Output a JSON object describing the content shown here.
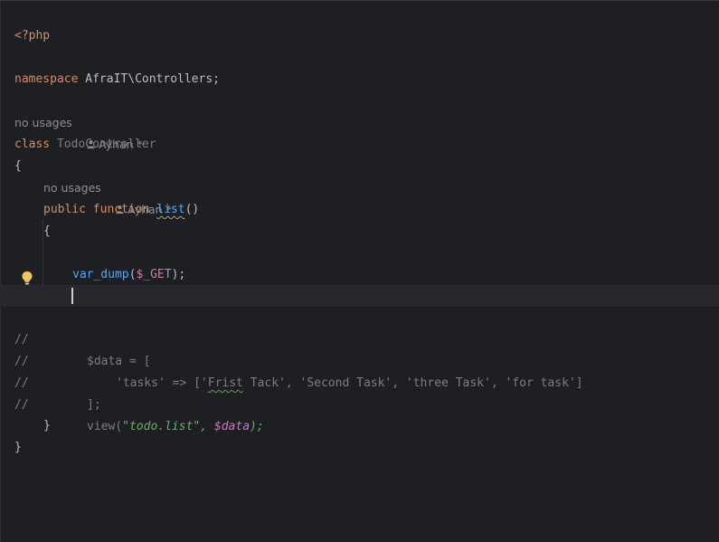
{
  "editor": {
    "lines": {
      "php_open": "<?php",
      "namespace_kw": "namespace",
      "namespace_name": " AfraIT\\Controllers;",
      "class_kw": "class",
      "class_name": " TodoController",
      "open_brace": "{",
      "public_kw": "public",
      "function_kw": " function ",
      "method_name": "list",
      "method_parens": "()",
      "method_open": "{",
      "var_dump_fn": "var_dump",
      "var_dump_open": "(",
      "var_dump_arg": "$_GET",
      "var_dump_close": ");",
      "c1_slashes": "//",
      "c1_code": "$data = [",
      "c2_slashes": "//",
      "c2_a": "'tasks' => ['",
      "c2_frist": "Frist",
      "c2_b": " Tack', 'Second Task', 'three Task', 'for task']",
      "c3_slashes": "//",
      "c3_code": "];",
      "c4_slashes": "//",
      "c4_view": "view(",
      "c4_str": "\"todo.list\", ",
      "c4_var": "$data",
      "c4_end": ");",
      "method_close": "}",
      "class_close": "}"
    },
    "hints": {
      "class_usages": "no usages",
      "class_author": "Ayhan *",
      "method_usages": "no usages",
      "method_author": "Ayhan *"
    },
    "icons": {
      "bulb": "lightbulb-icon",
      "author": "person-icon"
    },
    "colors": {
      "keyword": "#cf8e6d",
      "function": "#56a8f5",
      "variable": "#c77dbb",
      "string": "#6aab73",
      "background": "#1e1f22"
    }
  }
}
